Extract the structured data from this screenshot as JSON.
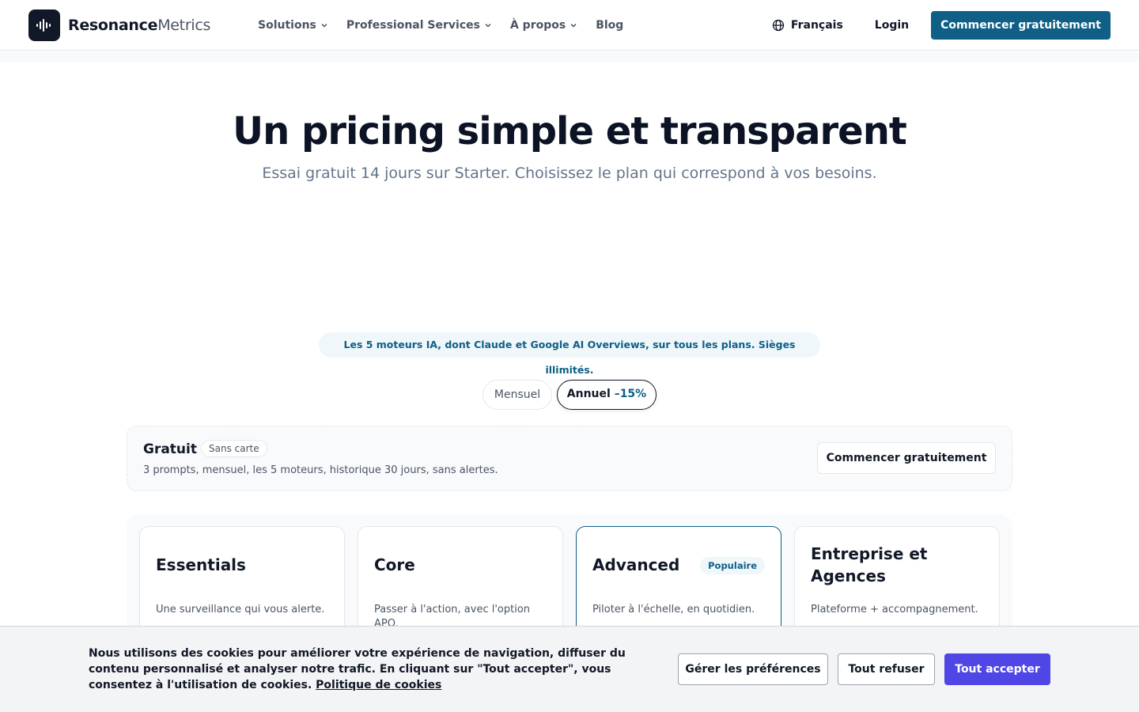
{
  "brand": {
    "name_bold": "Resonance",
    "name_light": "Metrics",
    "logo_icon": "waveform-icon"
  },
  "nav": {
    "items": [
      {
        "label": "Solutions",
        "has_dropdown": true
      },
      {
        "label": "Professional Services",
        "has_dropdown": true
      },
      {
        "label": "À propos",
        "has_dropdown": true
      },
      {
        "label": "Blog",
        "has_dropdown": false
      }
    ]
  },
  "header": {
    "language_label": "Français",
    "language_icon": "globe-icon",
    "login_label": "Login",
    "cta_label": "Commencer gratuitement"
  },
  "hero": {
    "title": "Un pricing simple et transparent",
    "subtitle": "Essai gratuit 14 jours sur Starter. Choisissez le plan qui correspond à vos besoins."
  },
  "engines_note": "Les 5 moteurs IA, dont Claude et Google AI Overviews, sur tous les plans. Sièges illimités.",
  "billing_toggle": {
    "monthly_label": "Mensuel",
    "annual_label": "Annuel",
    "annual_discount": "–15%",
    "selected": "Annuel"
  },
  "free_plan": {
    "name": "Gratuit",
    "badge": "Sans carte",
    "description": "3 prompts, mensuel, les 5 moteurs, historique 30 jours, sans alertes.",
    "cta_label": "Commencer gratuitement"
  },
  "plans": [
    {
      "name": "Essentials",
      "description": "Une surveillance qui vous alerte.",
      "badge": ""
    },
    {
      "name": "Core",
      "description": "Passer à l'action, avec l'option APO.",
      "badge": ""
    },
    {
      "name": "Advanced",
      "description": "Piloter à l'échelle, en quotidien.",
      "badge": "Populaire"
    },
    {
      "name": "Entreprise et Agences",
      "description": "Plateforme + accompagnement.",
      "badge": ""
    }
  ],
  "cookie_banner": {
    "text": "Nous utilisons des cookies pour améliorer votre expérience de navigation, diffuser du contenu personnalisé et analyser notre trafic. En cliquant sur \"Tout accepter\", vous consentez à l'utilisation de cookies.",
    "policy_link": "Politique de cookies",
    "manage_label": "Gérer les préférences",
    "refuse_label": "Tout refuser",
    "accept_label": "Tout accepter"
  },
  "colors": {
    "primary": "#0f5f86",
    "accept_button": "#4f46e5",
    "text_dark": "#0f172a",
    "text_muted": "#64748b"
  }
}
